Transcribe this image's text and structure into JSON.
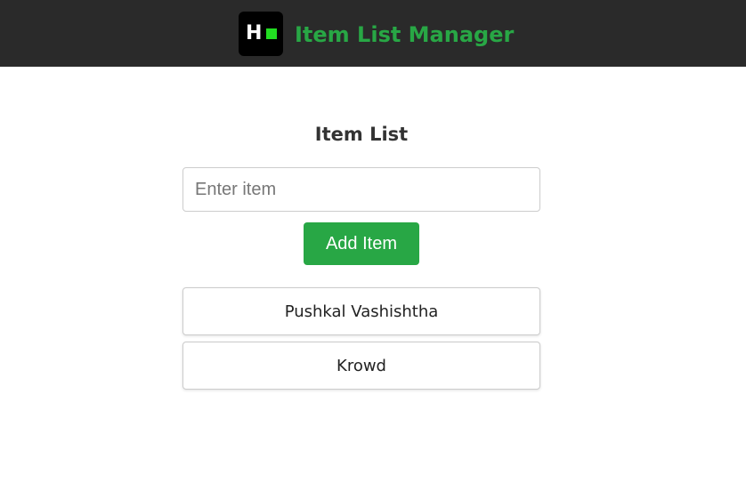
{
  "header": {
    "logo_letter": "H",
    "title": "Item List Manager"
  },
  "main": {
    "heading": "Item List",
    "input": {
      "value": "",
      "placeholder": "Enter item"
    },
    "add_button_label": "Add Item",
    "items": [
      {
        "label": "Pushkal Vashishtha"
      },
      {
        "label": "Krowd"
      }
    ]
  },
  "colors": {
    "header_background": "#2a2a2a",
    "accent": "#28a745",
    "logo_square": "#22dd22"
  },
  "icons": {
    "logo": "logo-icon"
  }
}
